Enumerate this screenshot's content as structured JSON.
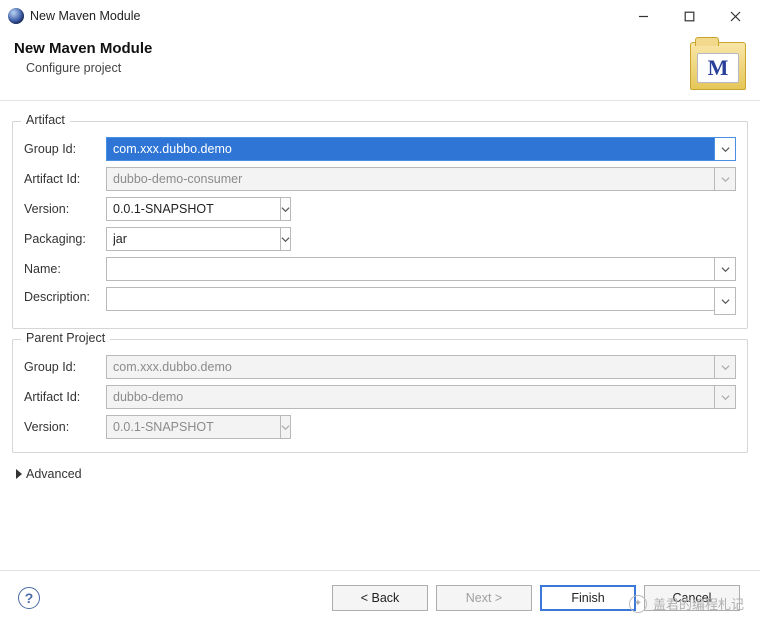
{
  "window": {
    "title": "New Maven Module"
  },
  "banner": {
    "heading": "New Maven Module",
    "subheading": "Configure project",
    "icon_letter": "M"
  },
  "artifact": {
    "legend": "Artifact",
    "labels": {
      "group_id": "Group Id:",
      "artifact_id": "Artifact Id:",
      "version": "Version:",
      "packaging": "Packaging:",
      "name": "Name:",
      "description": "Description:"
    },
    "values": {
      "group_id": "com.xxx.dubbo.demo",
      "artifact_id": "dubbo-demo-consumer",
      "version": "0.0.1-SNAPSHOT",
      "packaging": "jar",
      "name": "",
      "description": ""
    }
  },
  "parent": {
    "legend": "Parent Project",
    "labels": {
      "group_id": "Group Id:",
      "artifact_id": "Artifact Id:",
      "version": "Version:"
    },
    "values": {
      "group_id": "com.xxx.dubbo.demo",
      "artifact_id": "dubbo-demo",
      "version": "0.0.1-SNAPSHOT"
    }
  },
  "advanced": {
    "label": "Advanced"
  },
  "buttons": {
    "back": "< Back",
    "next": "Next >",
    "finish": "Finish",
    "cancel": "Cancel"
  },
  "help_glyph": "?",
  "watermark": "盖君的编程札记"
}
